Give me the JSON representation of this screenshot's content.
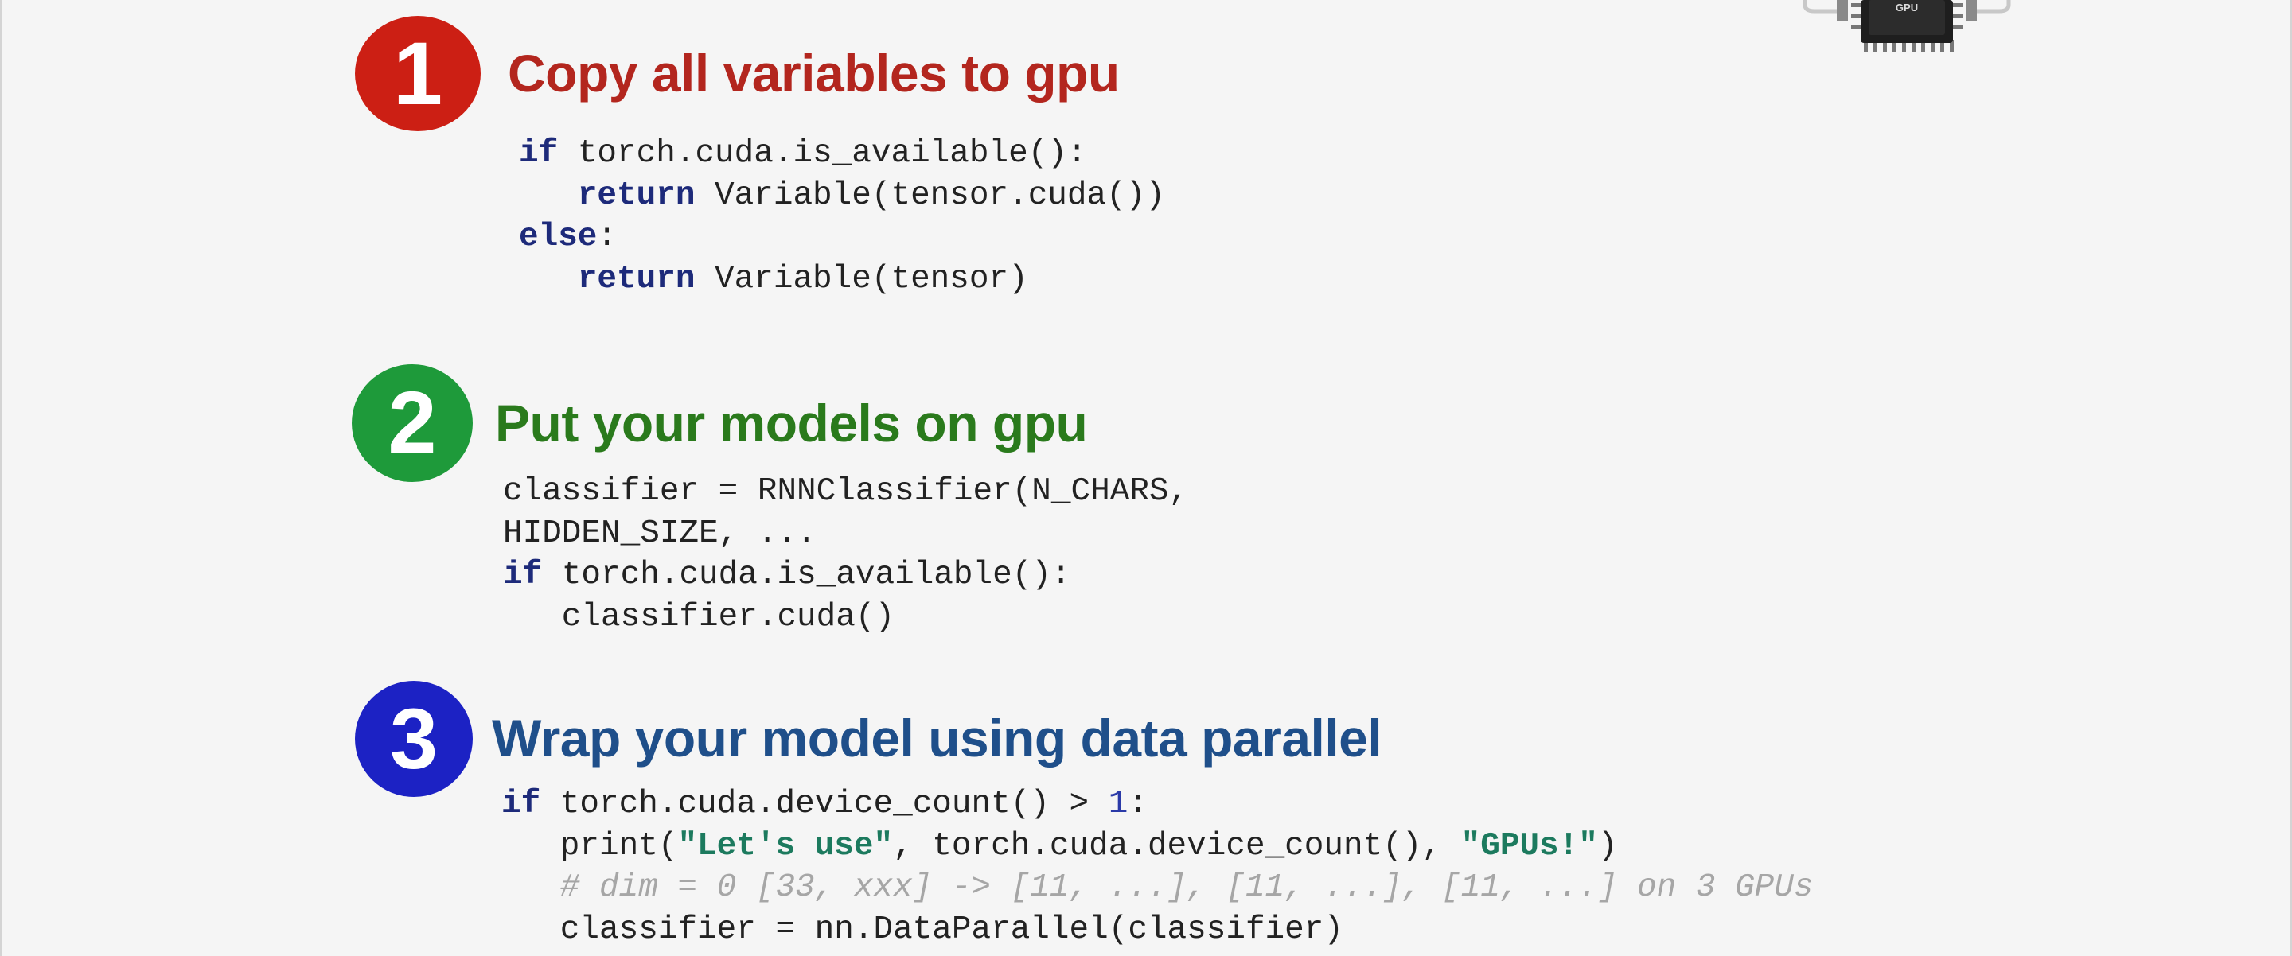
{
  "steps": [
    {
      "number": "1",
      "title": "Copy all variables to gpu",
      "code": {
        "l1_kw": "if",
        "l1_rest": " torch.cuda.is_available():",
        "l2_indent": "   ",
        "l2_kw": "return",
        "l2_rest": " Variable(tensor.cuda())",
        "l3_kw": "else",
        "l3_rest": ":",
        "l4_indent": "   ",
        "l4_kw": "return",
        "l4_rest": " Variable(tensor)"
      }
    },
    {
      "number": "2",
      "title": "Put your models on gpu",
      "code": {
        "l1": "classifier = RNNClassifier(N_CHARS,",
        "l2": "HIDDEN_SIZE, ...",
        "l3_kw": "if",
        "l3_rest": " torch.cuda.is_available():",
        "l4": "   classifier.cuda()"
      }
    },
    {
      "number": "3",
      "title": "Wrap your model using data parallel",
      "code": {
        "l1_kw": "if",
        "l1_rest": " torch.cuda.device_count() > ",
        "l1_num": "1",
        "l1_end": ":",
        "l2_pre": "   print(",
        "l2_str1": "\"Let's use\"",
        "l2_mid": ", torch.cuda.device_count(), ",
        "l2_str2": "\"GPUs!\"",
        "l2_end": ")",
        "l3": "   # dim = 0 [33, xxx] -> [11, ...], [11, ...], [11, ...] on 3 GPUs",
        "l4": "   classifier = nn.DataParallel(classifier)"
      }
    }
  ],
  "gpu_chip": {
    "label": "GPU"
  },
  "colors": {
    "step1": "#cc1f14",
    "step1_title": "#b3261e",
    "step2": "#1e9a3a",
    "step2_title": "#2a7a1c",
    "step3": "#1c22c4",
    "step3_title": "#1f4f8a"
  }
}
